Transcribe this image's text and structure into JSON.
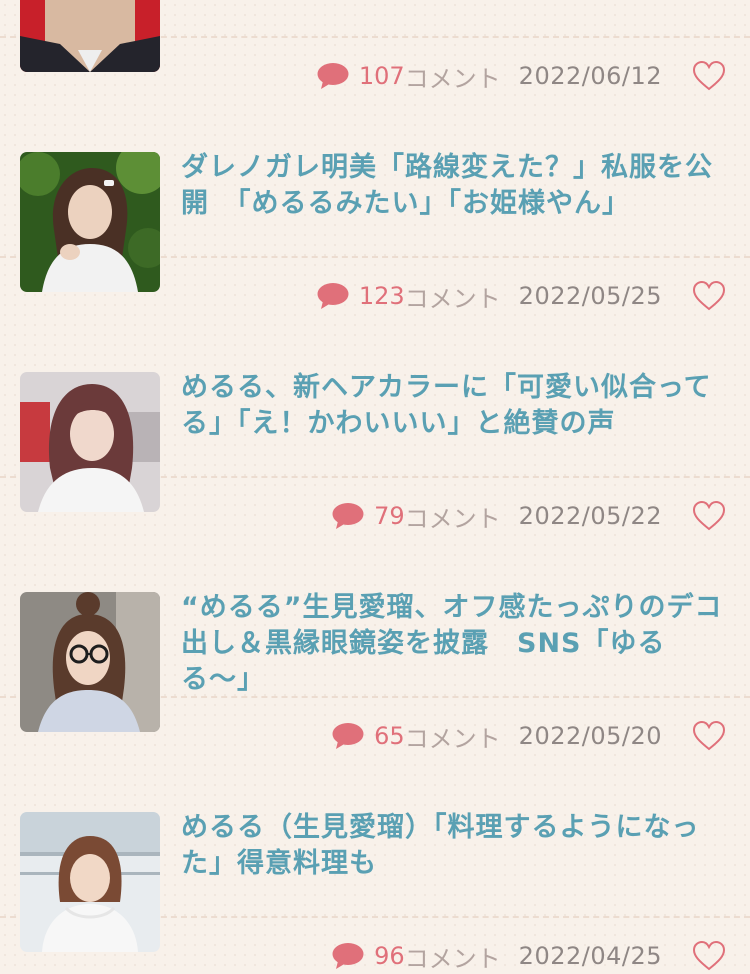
{
  "colors": {
    "background": "#f8f1ea",
    "title": "#5aa0b3",
    "accent_pink": "#e0707a",
    "meta_gray": "#8f8785"
  },
  "comment_icon": "speech-bubble-icon",
  "like_icon": "heart-outline-icon",
  "articles": [
    {
      "title": "",
      "comment_count": "107",
      "comment_label": "コメント",
      "date": "2022/06/12"
    },
    {
      "title": "ダレノガレ明美「路線変えた？」私服を公開　「めるるみたい」「お姫様やん」",
      "comment_count": "123",
      "comment_label": "コメント",
      "date": "2022/05/25"
    },
    {
      "title": "めるる、新ヘアカラーに「可愛い似合ってる」「え！かわいいい」と絶賛の声",
      "comment_count": "79",
      "comment_label": "コメント",
      "date": "2022/05/22"
    },
    {
      "title": "“めるる”生見愛瑠、オフ感たっぷりのデコ出し＆黒縁眼鏡姿を披露　SNS「ゆるる〜」",
      "comment_count": "65",
      "comment_label": "コメント",
      "date": "2022/05/20"
    },
    {
      "title": "めるる（生見愛瑠）「料理するようになった」得意料理も",
      "comment_count": "96",
      "comment_label": "コメント",
      "date": "2022/04/25"
    }
  ]
}
